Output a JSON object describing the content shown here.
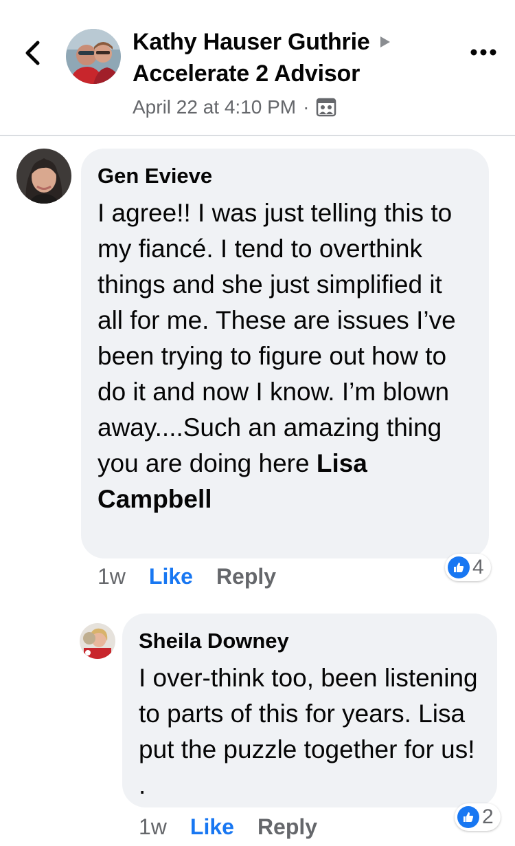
{
  "header": {
    "poster_name": "Kathy Hauser Guthrie",
    "group_name": "Accelerate 2 Advisor",
    "timestamp": "April 22 at 4:10 PM",
    "separator": "·",
    "icons": {
      "back": "chevron-left-icon",
      "arrow": "caret-right-icon",
      "privacy": "group-privacy-icon",
      "more": "more-options-icon"
    }
  },
  "comments": [
    {
      "author": "Gen Evieve",
      "text_before": "I agree!! I was just telling this to my fiancé. I tend to overthink things and she just simplified it all for me. These are issues I’ve been trying to figure out how to do it and now I know.  I’m blown away....Such an amazing thing you are doing here ",
      "mention": "Lisa Campbell",
      "time": "1w",
      "like_label": "Like",
      "reply_label": "Reply",
      "reaction_count": "4"
    },
    {
      "author": "Sheila Downey",
      "text": "I over-think too, been listening to parts of this for years. Lisa put the puzzle together for us! .",
      "time": "1w",
      "like_label": "Like",
      "reply_label": "Reply",
      "reaction_count": "2"
    }
  ],
  "colors": {
    "link_blue": "#1877f2",
    "bubble_bg": "#f0f2f5",
    "secondary_text": "#65676b"
  }
}
